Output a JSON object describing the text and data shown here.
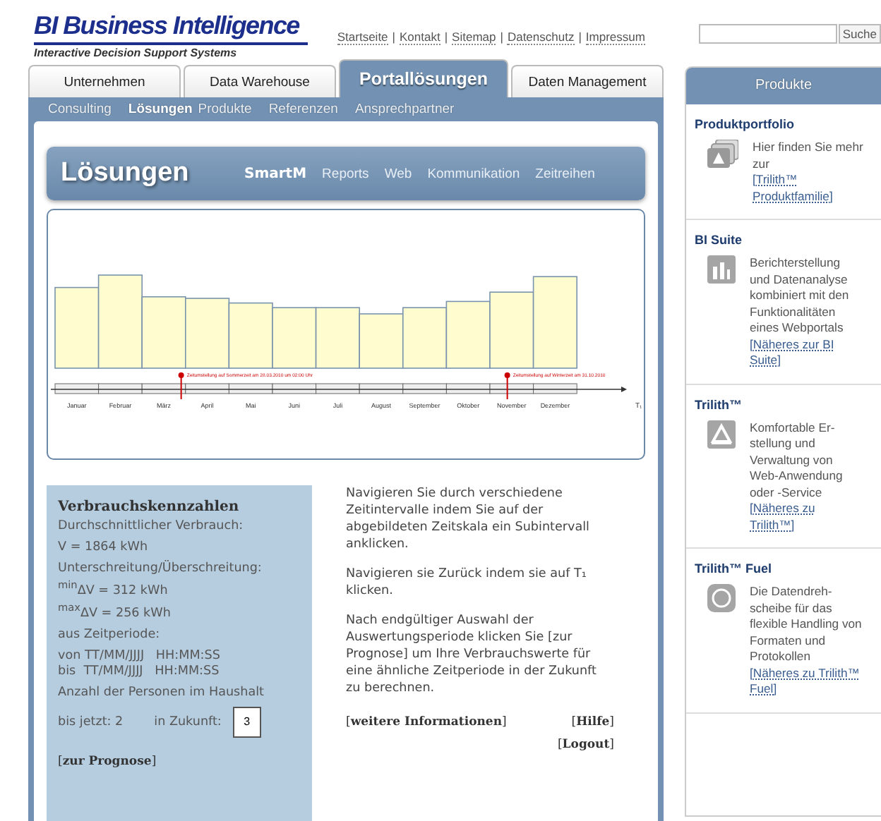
{
  "header": {
    "logo_title": "BI Business Intelligence",
    "logo_subtitle": "Interactive Decision Support Systems",
    "top_links": [
      "Startseite",
      "Kontakt",
      "Sitemap",
      "Datenschutz",
      "Impressum"
    ],
    "link_separator": "|",
    "search": {
      "button": "Suche"
    }
  },
  "tabs": [
    {
      "label": "Unternehmen",
      "selected": false
    },
    {
      "label": "Data Warehouse",
      "selected": false
    },
    {
      "label": "Portallösungen",
      "selected": true
    },
    {
      "label": "Daten Management",
      "selected": false
    }
  ],
  "subnav": [
    {
      "label": "Consulting",
      "selected": false
    },
    {
      "label": "Lösungen",
      "selected": true
    },
    {
      "label": "Produkte",
      "selected": false
    },
    {
      "label": "Referenzen",
      "selected": false
    },
    {
      "label": "Ansprechpartner",
      "selected": false
    }
  ],
  "section": {
    "title": "Lösungen",
    "links": [
      {
        "label": "SmartM",
        "selected": true
      },
      {
        "label": "Reports",
        "selected": false
      },
      {
        "label": "Web",
        "selected": false
      },
      {
        "label": "Kommunikation",
        "selected": false
      },
      {
        "label": "Zeitreihen",
        "selected": false
      }
    ]
  },
  "timeline": {
    "months": [
      "Januar",
      "Februar",
      "März",
      "April",
      "Mai",
      "Juni",
      "Juli",
      "August",
      "September",
      "Oktober",
      "November",
      "Dezember"
    ],
    "axis_label": "T₁",
    "annotations": [
      {
        "text": "Zeitumstellung auf Sommerzeit am 28.03.2010 um 02:00 Uhr"
      },
      {
        "text": "Zeitumstellung auf Winterzeit am 31.10.2010"
      }
    ]
  },
  "stats": {
    "title": "Verbrauchskennzahlen",
    "groups": [
      [
        "Durchschnittlicher Verbrauch:"
      ],
      [
        "V = 1864 kWh"
      ],
      [
        "Unterschreitung/Überschreitung:",
        "$^{min}$ΔV = 312 kWh",
        "$^{max}$ΔV = 256 kWh"
      ],
      [
        "aus Zeitperiode:"
      ],
      [
        "von TT/MM/JJJJ   HH:MM:SS",
        "bis  TT/MM/JJJJ   HH:MM:SS"
      ],
      [
        "Anzahl der Personen im Haushalt"
      ]
    ],
    "persons_now": "bis jetzt: 2",
    "persons_future_label": "in Zukunft:",
    "persons_future_value": "3",
    "link": "[**zur Prognose**]"
  },
  "help": {
    "paragraphs": [
      "Navigieren Sie durch verschiedene Zeitintervalle indem Sie auf der abgebildeten Zeitskala ein Subintervall anklicken.",
      "Navigieren sie Zurück indem sie auf T₁ klicken.",
      "Nach endgültiger Auswahl der Auswertungsperiode klicken Sie [zur Prognose] um Ihre Verbrauchswerte für eine ähnliche Zeitperiode in der Zukunft zu berechnen."
    ],
    "more_link": "[**weitere Informationen**]",
    "help_link": "[**Hilfe**]",
    "logout_link": "[**Logout**]"
  },
  "sidebar": {
    "title": "Produkte",
    "items": [
      {
        "heading": "Produktportfolio",
        "kind": "stack",
        "text": "Hier finden Sie mehr zur",
        "link": "[Trilith™ Produktfamilie]"
      },
      {
        "heading": "BI Suite",
        "kind": "bars",
        "text": "Berichterstellung und Datenanalyse kombiniert mit den Funktionalitäten eines Webportals",
        "link": "[Näheres zur BI Suite]"
      },
      {
        "heading": "Trilith™",
        "kind": "triangle",
        "text": "Komfortable Er-stellung und Verwaltung von Web-Anwendung oder -Service",
        "link": "[Näheres zu Trilith™]"
      },
      {
        "heading": "Trilith™ Fuel",
        "kind": "disc",
        "text": "Die Datendreh-scheibe für das flexible Handling von Formaten und Protokollen",
        "link": "[Näheres zu Trilith™ Fuel]"
      }
    ]
  }
}
